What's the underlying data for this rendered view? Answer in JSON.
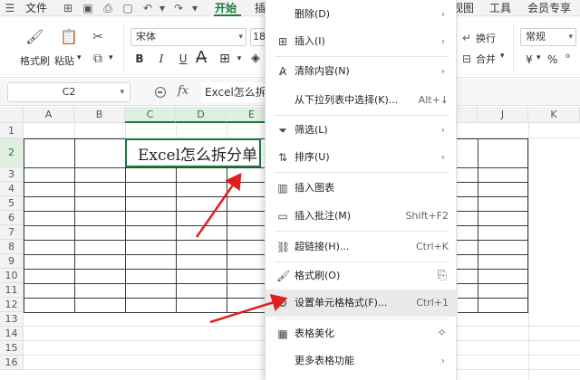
{
  "menubar": {
    "file_label": "文件",
    "home_tab": "开始",
    "insert_tab_partial": "插",
    "view_tab_partial": "视图",
    "tools_tab": "工具",
    "member_tab": "会员专享"
  },
  "ribbon": {
    "format_painter_label": "格式刷",
    "paste_label": "粘贴",
    "font_name": "宋体",
    "font_size_partial": "18",
    "wrap_label": "换行",
    "merge_label": "合并",
    "number_format": "常规",
    "currency_symbol": "¥",
    "percent_symbol": "%"
  },
  "formula_bar": {
    "cell_ref": "C2",
    "fx_label": "fx",
    "content_partial": "Excel怎么拆"
  },
  "grid": {
    "columns": [
      "A",
      "B",
      "C",
      "D",
      "E",
      "",
      "",
      "",
      "",
      "J",
      "K"
    ],
    "rows": [
      "1",
      "2",
      "3",
      "4",
      "5",
      "6",
      "7",
      "8",
      "9",
      "10",
      "11",
      "12",
      "13",
      "14",
      "15",
      "16"
    ],
    "cell_text": "Excel怎么拆分单"
  },
  "context_menu": {
    "items": [
      {
        "label": "删除(D)",
        "icon": "delete-icon",
        "shortcut": "",
        "arrow": "›"
      },
      {
        "label": "插入(I)",
        "icon": "insert-icon",
        "shortcut": "",
        "arrow": "›"
      },
      {
        "label": "清除内容(N)",
        "icon": "clear-icon",
        "shortcut": "",
        "arrow": "›"
      },
      {
        "label": "从下拉列表中选择(K)...",
        "icon": "",
        "shortcut": "Alt+↓",
        "arrow": ""
      },
      {
        "label": "筛选(L)",
        "icon": "filter-icon",
        "shortcut": "",
        "arrow": "›"
      },
      {
        "label": "排序(U)",
        "icon": "sort-icon",
        "shortcut": "",
        "arrow": "›"
      },
      {
        "label": "插入图表",
        "icon": "chart-icon",
        "shortcut": "",
        "arrow": ""
      },
      {
        "label": "插入批注(M)",
        "icon": "comment-icon",
        "shortcut": "Shift+F2",
        "arrow": ""
      },
      {
        "label": "超链接(H)...",
        "icon": "link-icon",
        "shortcut": "Ctrl+K",
        "arrow": ""
      },
      {
        "label": "格式刷(O)",
        "icon": "format-painter-icon",
        "shortcut": "",
        "arrow": ""
      },
      {
        "label": "设置单元格格式(F)...",
        "icon": "format-cells-icon",
        "shortcut": "Ctrl+1",
        "arrow": ""
      },
      {
        "label": "表格美化",
        "icon": "table-style-icon",
        "shortcut": "",
        "arrow": ""
      },
      {
        "label": "更多表格功能",
        "icon": "",
        "shortcut": "",
        "arrow": "›"
      }
    ]
  },
  "colors": {
    "accent": "#1a7a3f",
    "arrow": "#e02020",
    "highlight": "#eaeaea"
  }
}
